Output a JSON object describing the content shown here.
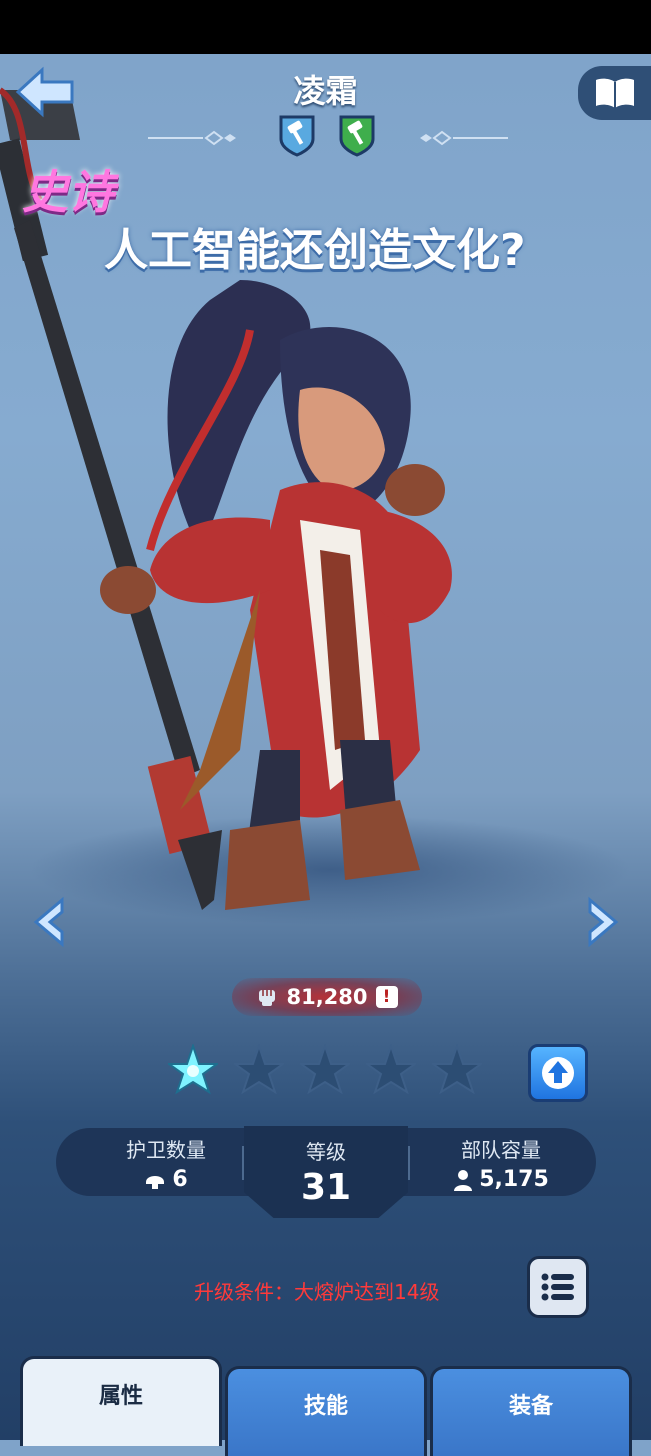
{
  "header": {
    "title": "凌霜",
    "class_icons": [
      "hammer-blue-shield-icon",
      "hammer-green-shield-icon"
    ]
  },
  "hero": {
    "rarity": "史诗",
    "overlay_text": "人工智能还创造文化?",
    "power": "81,280",
    "power_alert": "!",
    "stars_total": 5,
    "stars_active": 1
  },
  "stats": {
    "guard_label": "护卫数量",
    "guard_value": "6",
    "level_label": "等级",
    "level_value": "31",
    "troop_label": "部队容量",
    "troop_value": "5,175"
  },
  "upgrade": {
    "requirement": "升级条件：大熔炉达到14级"
  },
  "tabs": [
    {
      "label": "属性",
      "active": true
    },
    {
      "label": "技能",
      "active": false
    },
    {
      "label": "装备",
      "active": false
    }
  ],
  "colors": {
    "accent_blue": "#3a76c8",
    "requirement_red": "#ff3a3a",
    "rarity_pink": "#ff77e0"
  }
}
